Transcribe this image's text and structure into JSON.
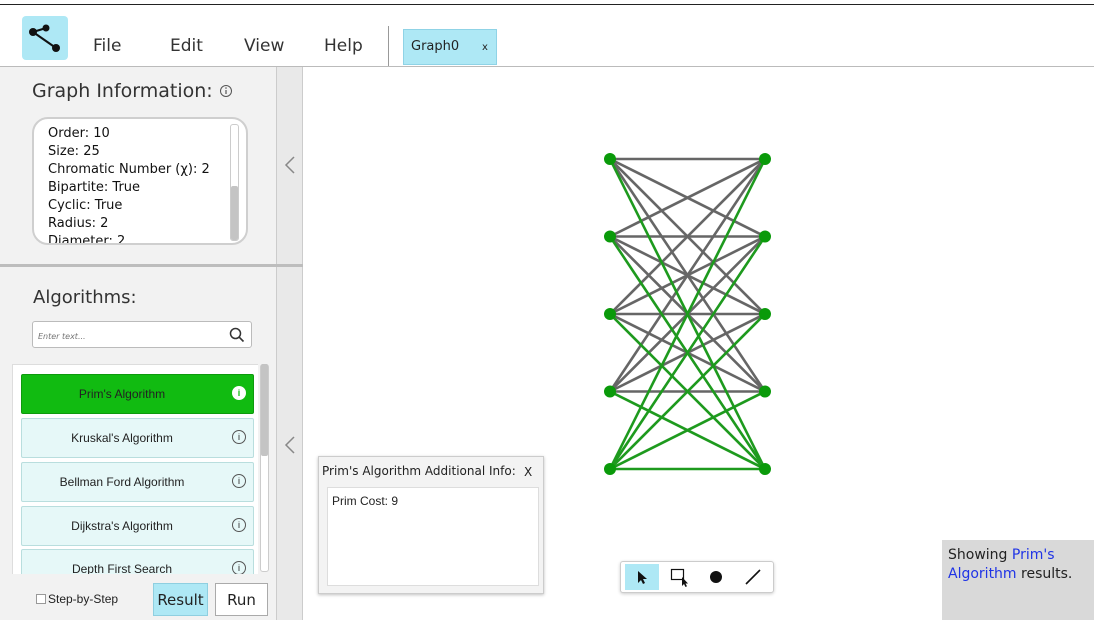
{
  "menu": {
    "file": "File",
    "edit": "Edit",
    "view": "View",
    "help": "Help"
  },
  "tabs": [
    {
      "label": "Graph0",
      "close": "x"
    }
  ],
  "graph_info": {
    "title": "Graph Information:",
    "info_icon": "info-circle-icon",
    "lines": [
      "Order: 10",
      "Size: 25",
      "Chromatic Number (χ): 2",
      "Bipartite: True",
      "Cyclic: True",
      "Radius: 2",
      "Diameter: 2"
    ]
  },
  "algorithms": {
    "title": "Algorithms:",
    "search_placeholder": "Enter text...",
    "items": [
      {
        "label": "Prim's Algorithm",
        "active": true
      },
      {
        "label": "Kruskal's Algorithm",
        "active": false
      },
      {
        "label": "Bellman Ford Algorithm",
        "active": false
      },
      {
        "label": "Dijkstra's Algorithm",
        "active": false
      },
      {
        "label": "Depth First Search",
        "active": false
      }
    ],
    "info_glyph": "i"
  },
  "controls": {
    "step_by_step": "Step-by-Step",
    "result": "Result",
    "run": "Run"
  },
  "additional_info": {
    "title": "Prim's Algorithm Additional Info:",
    "close": "X",
    "cost": "Prim Cost: 9"
  },
  "toolbar": {
    "tools": [
      "select-tool",
      "box-select-tool",
      "add-vertex-tool",
      "add-edge-tool"
    ],
    "active": "select-tool"
  },
  "status": {
    "prefix": "Showing ",
    "highlight": "Prim's Algorithm",
    "suffix": " results."
  },
  "graph": {
    "left_nodes": [
      "L1",
      "L2",
      "L3",
      "L4",
      "L5"
    ],
    "right_nodes": [
      "R1",
      "R2",
      "R3",
      "R4",
      "R5"
    ],
    "node_color": "#0a9a0a",
    "mst_edge_color": "#1e9a1e",
    "edge_color": "#666666",
    "edges": [
      {
        "from": "L1",
        "to": "R1",
        "mst": false
      },
      {
        "from": "L1",
        "to": "R2",
        "mst": false
      },
      {
        "from": "L1",
        "to": "R3",
        "mst": false
      },
      {
        "from": "L1",
        "to": "R4",
        "mst": false
      },
      {
        "from": "L1",
        "to": "R5",
        "mst": true
      },
      {
        "from": "L2",
        "to": "R1",
        "mst": false
      },
      {
        "from": "L2",
        "to": "R2",
        "mst": false
      },
      {
        "from": "L2",
        "to": "R3",
        "mst": false
      },
      {
        "from": "L2",
        "to": "R4",
        "mst": false
      },
      {
        "from": "L2",
        "to": "R5",
        "mst": true
      },
      {
        "from": "L3",
        "to": "R1",
        "mst": false
      },
      {
        "from": "L3",
        "to": "R2",
        "mst": false
      },
      {
        "from": "L3",
        "to": "R3",
        "mst": false
      },
      {
        "from": "L3",
        "to": "R4",
        "mst": false
      },
      {
        "from": "L3",
        "to": "R5",
        "mst": true
      },
      {
        "from": "L4",
        "to": "R1",
        "mst": false
      },
      {
        "from": "L4",
        "to": "R2",
        "mst": false
      },
      {
        "from": "L4",
        "to": "R3",
        "mst": false
      },
      {
        "from": "L4",
        "to": "R4",
        "mst": false
      },
      {
        "from": "L4",
        "to": "R5",
        "mst": true
      },
      {
        "from": "L5",
        "to": "R1",
        "mst": true
      },
      {
        "from": "L5",
        "to": "R2",
        "mst": true
      },
      {
        "from": "L5",
        "to": "R3",
        "mst": true
      },
      {
        "from": "L5",
        "to": "R4",
        "mst": true
      },
      {
        "from": "L5",
        "to": "R5",
        "mst": true
      }
    ]
  }
}
